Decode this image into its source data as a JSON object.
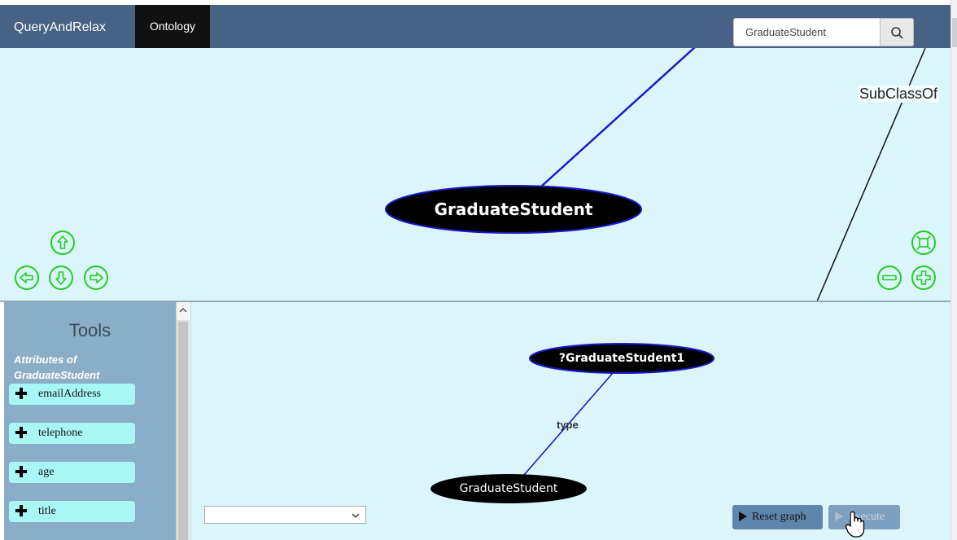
{
  "navbar": {
    "brand": "QueryAndRelax",
    "tab_ontology": "Ontology",
    "search_value": "GraduateStudent",
    "search_icon": "search-icon"
  },
  "graph": {
    "main_node": "GraduateStudent",
    "edge_label": "SubClassOf",
    "nav_icons": [
      "arrow-up-icon",
      "arrow-left-icon",
      "arrow-down-icon",
      "arrow-right-icon"
    ],
    "zoom_icons": [
      "fit-view-icon",
      "zoom-out-icon",
      "zoom-in-icon"
    ]
  },
  "tools": {
    "title": "Tools",
    "attributes_heading_line1": "Attributes of",
    "attributes_heading_line2": "GraduateStudent",
    "attributes": [
      "emailAddress",
      "telephone",
      "age",
      "title"
    ]
  },
  "query": {
    "variable_node": "?GraduateStudent1",
    "edge_label": "type",
    "class_node": "GraduateStudent",
    "select_value": "",
    "reset_label": "Reset graph",
    "execute_label": "Execute"
  },
  "colors": {
    "navbar": "#466285",
    "active_tab": "#111111",
    "graph_bg": "#dbf6fb",
    "node_fill": "#000000",
    "node_stroke": "#1a1acc",
    "edge": "#1a1acc",
    "control_icons": "#22cc22",
    "sidebar": "#8aaec8",
    "attribute_button": "#a8f7f4",
    "action_button": "#5e86ad"
  }
}
